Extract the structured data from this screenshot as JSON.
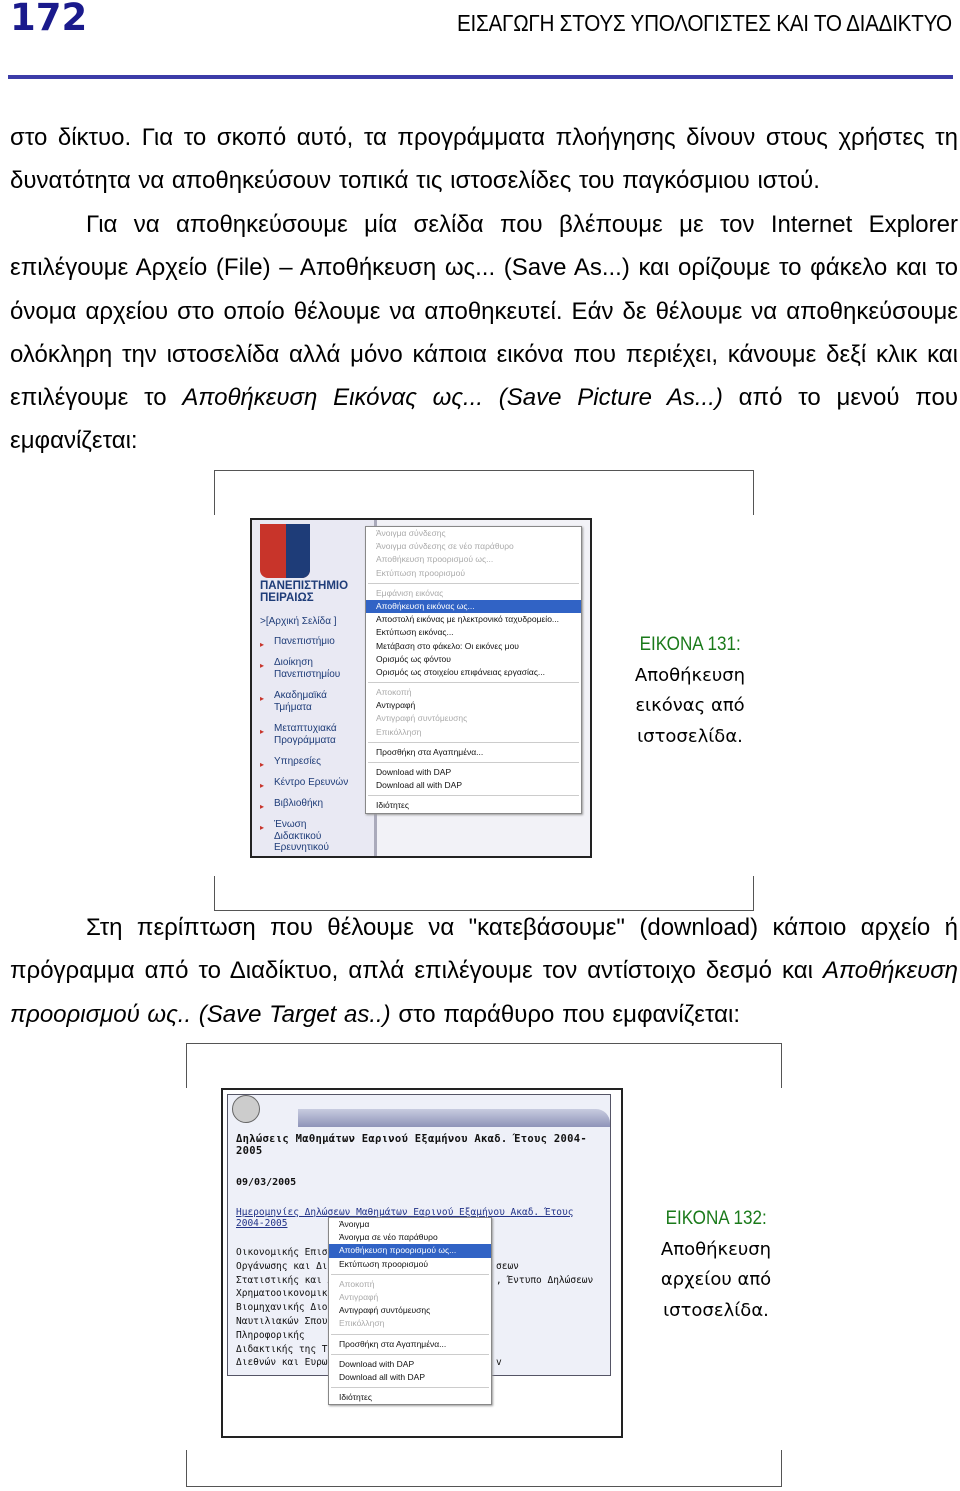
{
  "header": {
    "page_number": "172",
    "title": "ΕΙΣΑΓΩΓΗ ΣΤΟΥΣ ΥΠΟΛΟΓΙΣΤΕΣ ΚΑΙ ΤΟ ΔΙΑΔΙΚΤΥΟ",
    "rule_color": "#3c3ca8"
  },
  "body": {
    "p1": "στο δίκτυο. Για το σκοπό αυτό, τα προγράμματα πλοήγησης δίνουν στους χρήστες τη δυνατότητα να αποθηκεύσουν τοπικά τις ιστοσελίδες του παγκόσμιου ιστού.",
    "p2_a": "Για να αποθηκεύσουμε μία σελίδα που βλέπουμε με τον Internet Explorer επιλέγουμε Αρχείο (File) – Αποθήκευση ως... (Save As...) και ορίζουμε το φάκελο και το όνομα αρχείου στο οποίο θέλουμε να αποθηκευτεί. Εάν δε θέλουμε να αποθηκεύσουμε ολόκληρη την ιστοσελίδα αλλά μόνο κάποια εικόνα που περιέχει, κάνουμε δεξί κλικ και επιλέγουμε το ",
    "p2_b": "Αποθήκευση Εικόνας ως... (Save Picture As...)",
    "p2_c": " από το μενού που εμφανίζεται:",
    "p3_a": "Στη περίπτωση που θέλουμε να \"κατεβάσουμε\" (download) κάποιο αρχείο ή πρόγραμμα από το Διαδίκτυο, απλά επιλέγουμε τον αντίστοιχο δεσμό και ",
    "p3_b": "Αποθήκευση προορισμού ως.. (Save Target as..)",
    "p3_c": "  στο παράθυρο που εμφανίζεται:"
  },
  "figure1": {
    "caption_title": "ΕΙΚΟΝΑ 131:",
    "caption_lines": [
      "Αποθήκευση",
      "εικόνας από",
      "ιστοσελίδα."
    ],
    "site_name": [
      "ΠΑΝΕΠΙΣΤΗΜΙΟ",
      "ΠΕΙΡΑΙΩΣ"
    ],
    "home": ">[Αρχική Σελίδα    ]",
    "nav": [
      [
        "Πανεπιστήμιο"
      ],
      [
        "Διοίκηση",
        "Πανεπιστημίου"
      ],
      [
        "Ακαδημαϊκά",
        "Τμήματα"
      ],
      [
        "Μεταπτυχιακά",
        "Προγράμματα"
      ],
      [
        "Υπηρεσίες"
      ],
      [
        "Κέντρο Ερευνών"
      ],
      [
        "Βιβλιοθήκη"
      ],
      [
        "Ένωση",
        "Διδακτικού",
        "Ερευνητικού"
      ]
    ],
    "menu": [
      [
        {
          "label": "Άνοιγμα σύνδεσης",
          "state": "disabled"
        },
        {
          "label": "Άνοιγμα σύνδεσης σε νέο παράθυρο",
          "state": "disabled"
        },
        {
          "label": "Αποθήκευση προορισμού ως...",
          "state": "disabled"
        },
        {
          "label": "Εκτύπωση προορισμού",
          "state": "disabled"
        }
      ],
      [
        {
          "label": "Εμφάνιση εικόνας",
          "state": "disabled"
        },
        {
          "label": "Αποθήκευση εικόνας ως...",
          "state": "selected"
        },
        {
          "label": "Αποστολή εικόνας με ηλεκτρονικό ταχυδρομείο...",
          "state": "enabled"
        },
        {
          "label": "Εκτύπωση εικόνας...",
          "state": "enabled"
        },
        {
          "label": "Μετάβαση στο φάκελο: Οι εικόνες μου",
          "state": "enabled"
        },
        {
          "label": "Ορισμός ως φόντου",
          "state": "enabled"
        },
        {
          "label": "Ορισμός ως στοιχείου επιφάνειας εργασίας...",
          "state": "enabled"
        }
      ],
      [
        {
          "label": "Αποκοπή",
          "state": "disabled"
        },
        {
          "label": "Αντιγραφή",
          "state": "enabled"
        },
        {
          "label": "Αντιγραφή συντόμευσης",
          "state": "disabled"
        },
        {
          "label": "Επικόλληση",
          "state": "disabled"
        }
      ],
      [
        {
          "label": "Προσθήκη στα Αγαπημένα...",
          "state": "enabled"
        }
      ],
      [
        {
          "label": "Download with DAP",
          "state": "enabled"
        },
        {
          "label": "Download all with DAP",
          "state": "enabled"
        }
      ],
      [
        {
          "label": "Ιδιότητες",
          "state": "enabled"
        }
      ]
    ]
  },
  "figure2": {
    "caption_title": "ΕΙΚΟΝΑ 132:",
    "caption_lines": [
      "Αποθήκευση",
      "αρχείου από",
      "ιστοσελίδα."
    ],
    "heading": "Δηλώσεις Μαθημάτων Εαρινού Εξαμήνου Ακαδ. Έτους 2004-2005",
    "date": "09/03/2005",
    "link": "Ημερομηνίες Δηλώσεων Μαθημάτων Εαρινού Εξαμήνου Ακαδ. Έτους 2004-2005",
    "list": [
      "Οικονομικής Επιστή",
      "Οργάνωσης και Διοί",
      "Στατιστικής και Ασφ",
      "Χρηματοοικονομικής",
      "Βιομηχανικής Διοίκη",
      "Ναυτιλιακών Σπουδ",
      "Πληροφορικής",
      "Διδακτικής της Τεχν",
      "Διεθνών και Ευρωπ"
    ],
    "right_bits": [
      "σεων",
      ", Έντυπο Δηλώσεων",
      "v"
    ],
    "menu": [
      [
        {
          "label": "Άνοιγμα",
          "state": "enabled"
        },
        {
          "label": "Άνοιγμα σε νέο παράθυρο",
          "state": "enabled"
        },
        {
          "label": "Αποθήκευση προορισμού ως...",
          "state": "selected"
        },
        {
          "label": "Εκτύπωση προορισμού",
          "state": "enabled"
        }
      ],
      [
        {
          "label": "Αποκοπή",
          "state": "disabled"
        },
        {
          "label": "Αντιγραφή",
          "state": "disabled"
        },
        {
          "label": "Αντιγραφή συντόμευσης",
          "state": "enabled"
        },
        {
          "label": "Επικόλληση",
          "state": "disabled"
        }
      ],
      [
        {
          "label": "Προσθήκη στα Αγαπημένα...",
          "state": "enabled"
        }
      ],
      [
        {
          "label": "Download with DAP",
          "state": "enabled"
        },
        {
          "label": "Download all with DAP",
          "state": "enabled"
        }
      ],
      [
        {
          "label": "Ιδιότητες",
          "state": "enabled"
        }
      ]
    ]
  }
}
